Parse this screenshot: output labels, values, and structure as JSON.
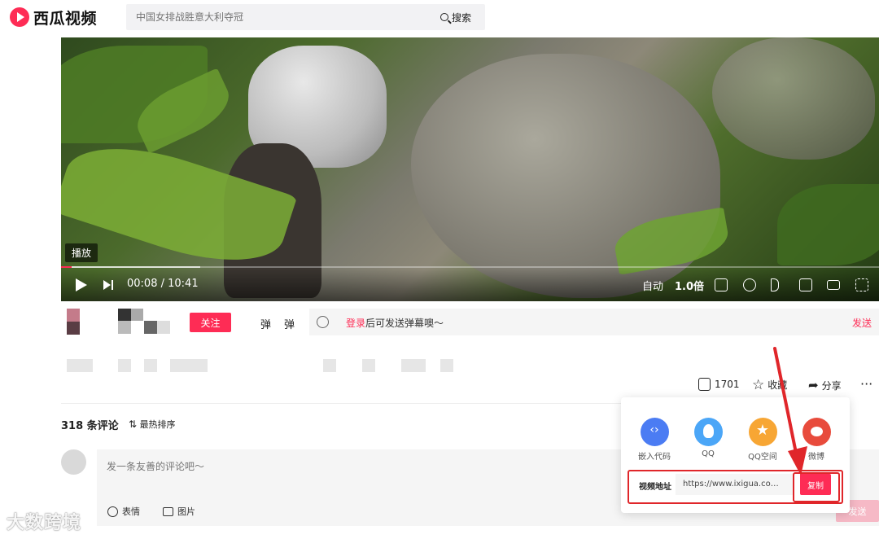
{
  "header": {
    "logo_text": "西瓜视频",
    "search_placeholder": "中国女排战胜意大利夺冠",
    "search_button": "搜索"
  },
  "player": {
    "play_tag": "播放",
    "current_time": "00:08",
    "duration": "10:41",
    "time_separator": " / ",
    "quality": "自动",
    "speed": "1.0倍",
    "progress_fraction": 0.013,
    "buffer_fraction": 0.17
  },
  "info_bar": {
    "follow_button": "关注",
    "danmaku_toggle_1": "弹",
    "danmaku_toggle_2": "弹",
    "danmaku_login": "登录",
    "danmaku_hint": "后可发送弹幕噢～",
    "danmaku_send": "发送"
  },
  "actions": {
    "like_count": "1701",
    "collect_label": "收藏",
    "share_label": "分享",
    "more_label": "···"
  },
  "comments": {
    "count_label": "318 条评论",
    "sort_label": "最热排序",
    "input_placeholder": "发一条友善的评论吧～",
    "emoji_label": "表情",
    "image_label": "图片",
    "send_button": "发送"
  },
  "share_popup": {
    "items": [
      {
        "label": "嵌入代码",
        "icon": "embed-code-icon",
        "color": "#4b7cf3"
      },
      {
        "label": "QQ",
        "icon": "qq-icon",
        "color": "#4ba6f7"
      },
      {
        "label": "QQ空间",
        "icon": "qzone-icon",
        "color": "#f7a634"
      },
      {
        "label": "微博",
        "icon": "weibo-icon",
        "color": "#e84b3c"
      }
    ],
    "url_label": "视频地址",
    "url_value": "https://www.ixigua.com/726...",
    "copy_button": "复制"
  },
  "watermark": "大数跨境",
  "colors": {
    "accent": "#fe2c55",
    "annotation_red": "#e0262a"
  }
}
